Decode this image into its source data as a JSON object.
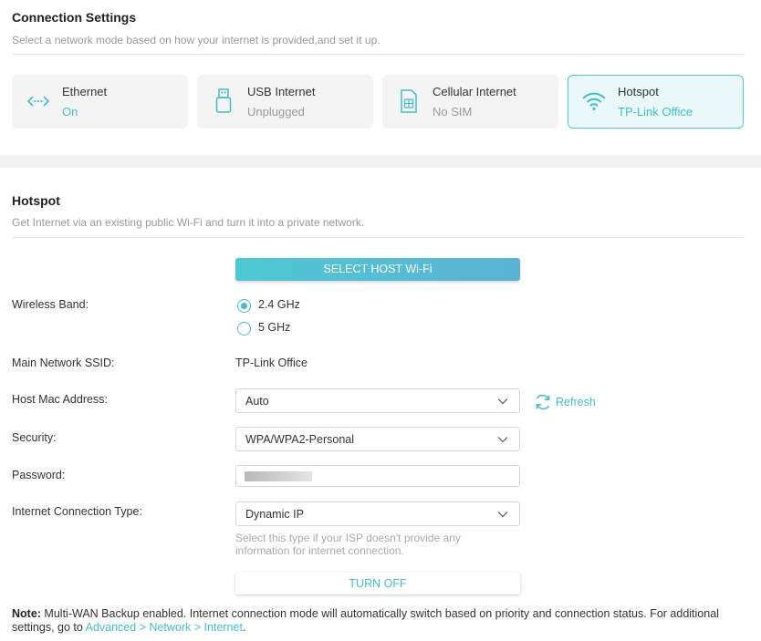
{
  "connection": {
    "title": "Connection Settings",
    "subtitle": "Select a network mode based on how your internet is provided,and set it up.",
    "cards": [
      {
        "name": "Ethernet",
        "status": "On",
        "icon": "ethernet-icon"
      },
      {
        "name": "USB Internet",
        "status": "Unplugged",
        "icon": "usb-icon"
      },
      {
        "name": "Cellular Internet",
        "status": "No SIM",
        "icon": "sim-card-icon"
      },
      {
        "name": "Hotspot",
        "status": "TP-Link Office",
        "icon": "wifi-icon"
      }
    ]
  },
  "hotspot": {
    "title": "Hotspot",
    "subtitle": "Get Internet via an existing public Wi-Fi and turn it into a private network.",
    "select_host_button": "SELECT HOST Wi-Fi",
    "wireless_band_label": "Wireless Band:",
    "band_options": [
      "2.4 GHz",
      "5 GHz"
    ],
    "band_selected": "2.4 GHz",
    "ssid_label": "Main Network SSID:",
    "ssid_value": "TP-Link Office",
    "mac_label": "Host Mac Address:",
    "mac_value": "Auto",
    "refresh_label": "Refresh",
    "security_label": "Security:",
    "security_value": "WPA/WPA2-Personal",
    "password_label": "Password:",
    "conn_type_label": "Internet Connection Type:",
    "conn_type_value": "Dynamic IP",
    "conn_type_hint": "Select this type if your ISP doesn't provide any information for internet connection.",
    "turn_off_button": "TURN OFF"
  },
  "note": {
    "prefix": "Note:",
    "text": " Multi-WAN Backup enabled. Internet connection mode will automatically switch based on priority and connection status. For additional settings, go to ",
    "link": "Advanced > Network > Internet",
    "suffix": "."
  },
  "colors": {
    "accent": "#3fbfc9",
    "active_card_bg": "#eaf8f9",
    "card_bg": "#f4f4f4",
    "band_bg": "#f2f2f2"
  }
}
